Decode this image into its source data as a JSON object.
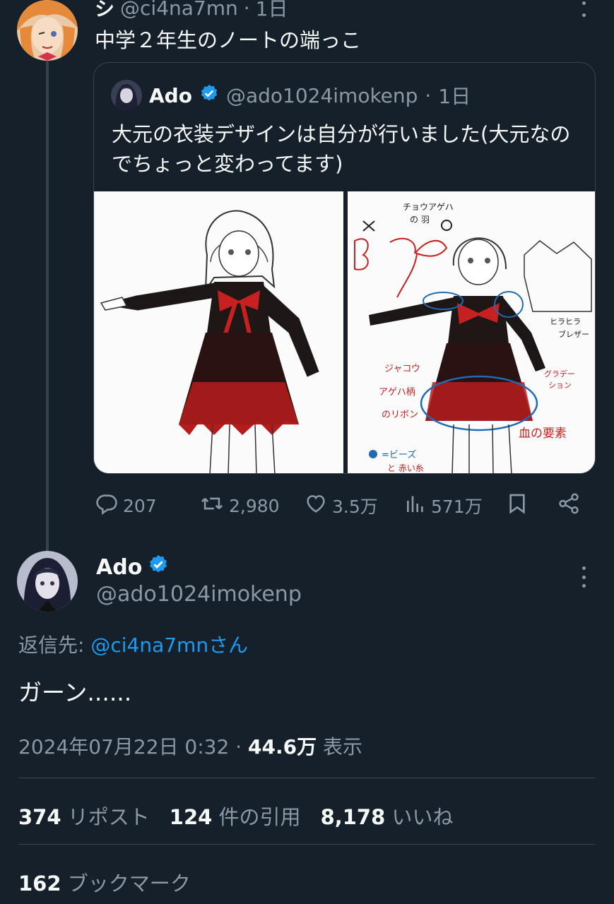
{
  "colors": {
    "background": "#15202b",
    "accent": "#1d9bf0",
    "muted": "#8b98a5",
    "text": "#f7f9f9"
  },
  "parent_tweet": {
    "name": "シ",
    "handle": "@ci4na7mn",
    "time": "1日",
    "text": "中学２年生のノートの端っこ"
  },
  "quote_tweet": {
    "name": "Ado",
    "handle": "@ado1024imokenp",
    "time": "1日",
    "text": "大元の衣装デザインは自分が行いました(大元なのでちょっと変わってます)",
    "sketch_annotations": [
      "チョウアゲハの羽",
      "ジャコウアゲハ柄のリボン",
      "ヒラヒラ",
      "ブレザー",
      "グラデーション",
      "血の要素",
      "●=ビーズと赤い糸"
    ]
  },
  "actions": {
    "replies": "207",
    "reposts": "2,980",
    "likes": "3.5万",
    "views": "571万"
  },
  "main_tweet": {
    "name": "Ado",
    "handle": "@ado1024imokenp",
    "reply_label": "返信先:",
    "reply_mention": "@ci4na7mnさん",
    "text": "ガーン......",
    "datetime": "2024年07月22日 0:32",
    "separator": "·",
    "view_count": "44.6万",
    "view_label": "表示",
    "repost_count": "374",
    "repost_label": "リポスト",
    "quote_count": "124",
    "quote_label": "件の引用",
    "like_count": "8,178",
    "like_label": "いいね",
    "bookmark_count": "162",
    "bookmark_label": "ブックマーク"
  }
}
